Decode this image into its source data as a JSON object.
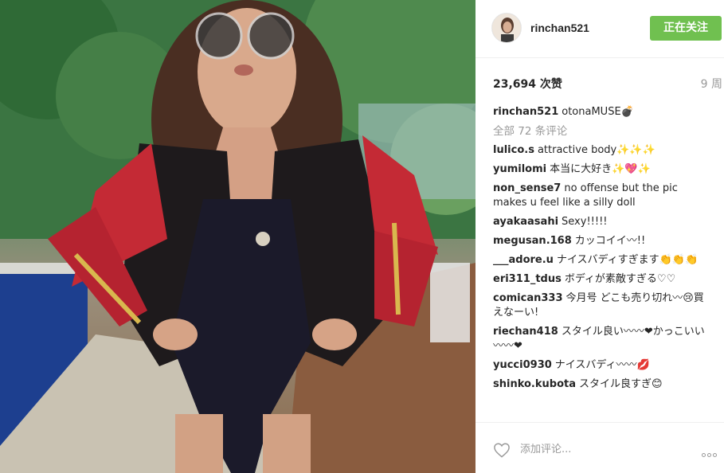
{
  "post": {
    "username": "rinchan521",
    "follow_label": "正在关注",
    "likes": "23,694 次赞",
    "time_ago": "9 周",
    "view_all": "全部 72 条评论",
    "add_comment_placeholder": "添加评论..."
  },
  "comments": [
    {
      "user": "rinchan521",
      "text": "otonaMUSE💣"
    },
    {
      "user": "lulico.s",
      "text": "attractive body✨✨✨"
    },
    {
      "user": "yumilomi",
      "text": "本当に大好き✨💖✨"
    },
    {
      "user": "non_sense7",
      "text": "no offense but the pic makes u feel like a silly doll"
    },
    {
      "user": "ayakaasahi",
      "text": "Sexy!!!!!"
    },
    {
      "user": "megusan.168",
      "text": "カッコイイ〰!!"
    },
    {
      "user": "___adore.u",
      "text": "ナイスバディすぎます👏​👏👏"
    },
    {
      "user": "eri311_tdus",
      "text": "ボディが素敵すぎる♡♡"
    },
    {
      "user": "comican333",
      "text": "今月号 どこも売り切れ〰😢買えなーい!"
    },
    {
      "user": "riechan418",
      "text": "スタイル良い〰〰❤かっこいい〰〰❤"
    },
    {
      "user": "yucci0930",
      "text": "ナイスバディ〰〰💋"
    },
    {
      "user": "shinko.kubota",
      "text": "スタイル良すぎ😊"
    }
  ],
  "colors": {
    "follow_button": "#70c050",
    "muted_text": "#999999",
    "primary_text": "#262626",
    "divider": "#efefef"
  }
}
